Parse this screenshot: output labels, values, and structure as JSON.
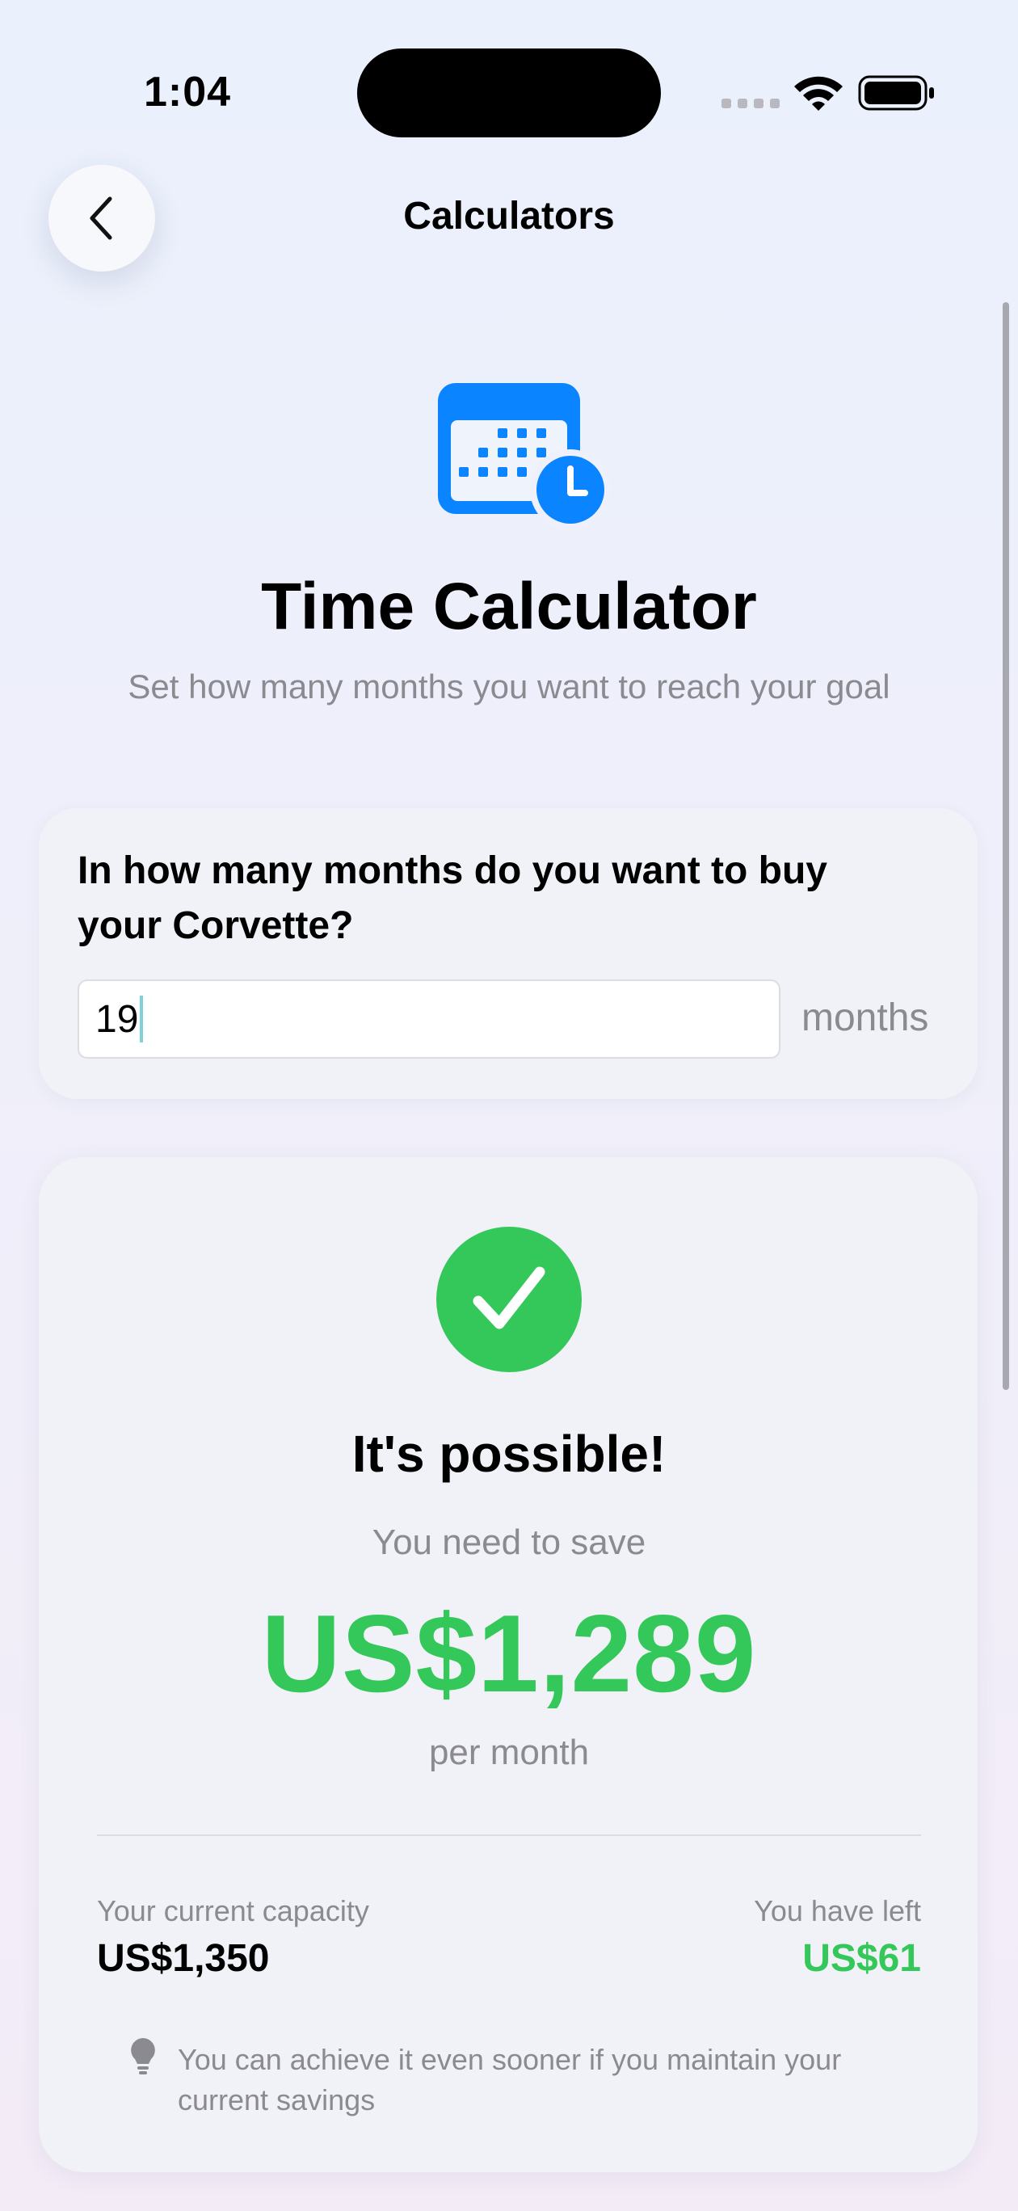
{
  "status_bar": {
    "time": "1:04"
  },
  "nav": {
    "title": "Calculators",
    "back_icon": "chevron-left-icon"
  },
  "hero": {
    "icon": "calendar-clock-icon",
    "title": "Time Calculator",
    "subtitle": "Set how many months you want to reach your goal"
  },
  "question": {
    "text": "In how many months do you want to buy your Corvette?",
    "input_value": "19",
    "unit": "months"
  },
  "result": {
    "icon": "checkmark-circle-icon",
    "title": "It's possible!",
    "need_label": "You need to save",
    "amount": "US$1,289",
    "period": "per month",
    "capacity_label": "Your current capacity",
    "capacity_value": "US$1,350",
    "left_label": "You have left",
    "left_value": "US$61",
    "tip": "You can achieve it even sooner if you maintain your current savings"
  },
  "colors": {
    "accent_blue": "#0a84ff",
    "success_green": "#34c759",
    "secondary_text": "#8a8a90"
  }
}
